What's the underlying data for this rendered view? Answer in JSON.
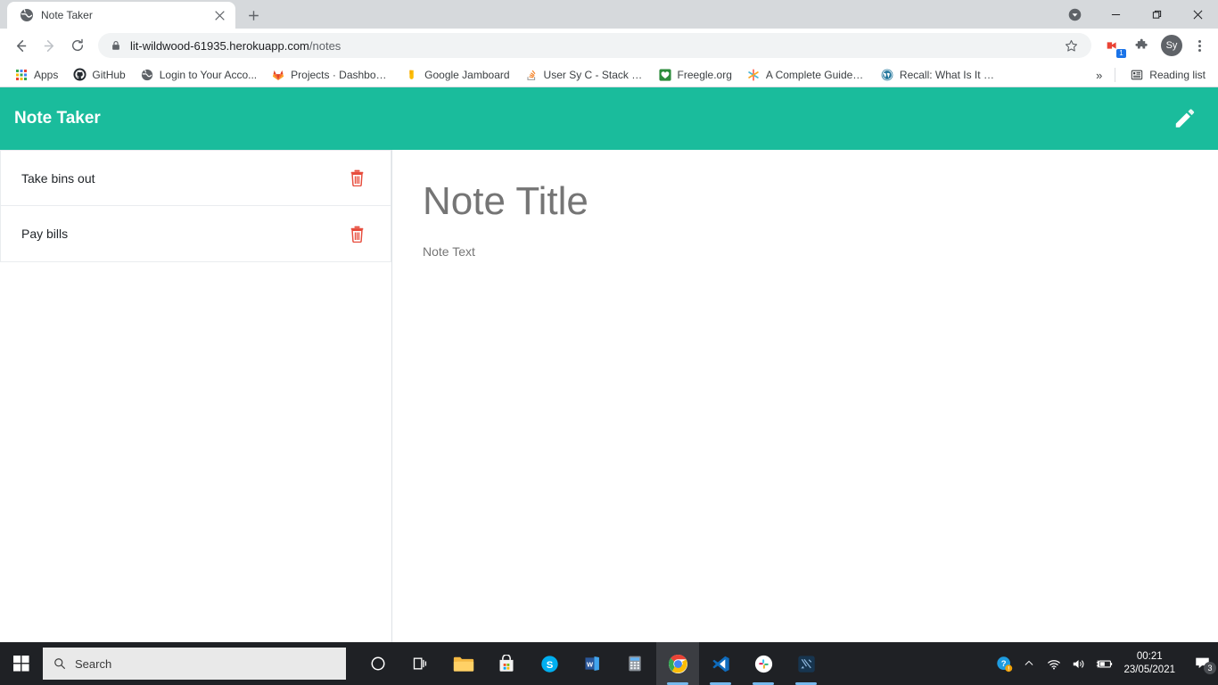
{
  "window": {
    "controls": {
      "download_icon": "download-chevron-icon",
      "minimize": "minimize",
      "maximize": "maximize",
      "close": "close"
    }
  },
  "tab": {
    "title": "Note Taker",
    "favicon": "globe-icon",
    "close_icon": "close-icon",
    "new_tab_icon": "plus-icon"
  },
  "toolbar": {
    "back_icon": "back-arrow-icon",
    "forward_icon": "forward-arrow-icon",
    "reload_icon": "reload-icon",
    "lock_icon": "lock-icon",
    "url_main": "lit-wildwood-61935.herokuapp.com",
    "url_path": "/notes",
    "star_icon": "star-icon",
    "extension_badge": "1",
    "puzzle_icon": "puzzle-icon",
    "avatar_label": "Sy",
    "menu_icon": "three-dot-menu-icon"
  },
  "bookmarks": {
    "items": [
      {
        "label": "Apps",
        "icon": "apps-grid-icon"
      },
      {
        "label": "GitHub",
        "icon": "github-icon"
      },
      {
        "label": "Login to Your Acco...",
        "icon": "globe-icon"
      },
      {
        "label": "Projects · Dashboar...",
        "icon": "gitlab-icon"
      },
      {
        "label": "Google Jamboard",
        "icon": "jamboard-icon"
      },
      {
        "label": "User Sy C - Stack O...",
        "icon": "stackoverflow-icon"
      },
      {
        "label": "Freegle.org",
        "icon": "freegle-icon"
      },
      {
        "label": "A Complete Guide t...",
        "icon": "asterisk-icon"
      },
      {
        "label": "Recall: What Is It G...",
        "icon": "wordpress-icon"
      }
    ],
    "overflow_label": "»",
    "reading_list_label": "Reading list",
    "reading_list_icon": "reading-list-icon"
  },
  "app": {
    "title": "Note Taker",
    "accent_color": "#1abc9c",
    "new_note_icon": "pencil-icon",
    "notes": [
      {
        "title": "Take bins out",
        "delete_icon": "trash-icon"
      },
      {
        "title": "Pay bills",
        "delete_icon": "trash-icon"
      }
    ],
    "editor": {
      "title_placeholder": "Note Title",
      "text_placeholder": "Note Text",
      "title_value": "",
      "text_value": ""
    }
  },
  "taskbar": {
    "start_icon": "windows-start-icon",
    "search": {
      "placeholder": "Search",
      "icon": "search-icon",
      "value": ""
    },
    "apps": [
      {
        "name": "task-view",
        "icon": "task-view-icon"
      },
      {
        "name": "file-explorer",
        "icon": "folder-icon"
      },
      {
        "name": "microsoft-store",
        "icon": "store-icon"
      },
      {
        "name": "skype",
        "icon": "skype-icon"
      },
      {
        "name": "word",
        "icon": "word-icon"
      },
      {
        "name": "calculator",
        "icon": "calculator-icon"
      },
      {
        "name": "google-chrome",
        "icon": "chrome-icon",
        "active": true
      },
      {
        "name": "visual-studio-code",
        "icon": "vscode-icon"
      },
      {
        "name": "slack",
        "icon": "slack-icon"
      },
      {
        "name": "insomnia",
        "icon": "insomnia-icon"
      }
    ],
    "tray": {
      "help_icon": "help-circle-icon",
      "chevron_icon": "chevron-up-icon",
      "wifi_icon": "wifi-icon",
      "volume_icon": "volume-icon",
      "battery_icon": "battery-charging-icon",
      "time": "00:21",
      "date": "23/05/2021",
      "notification_icon": "notification-icon",
      "notification_count": "3"
    }
  }
}
